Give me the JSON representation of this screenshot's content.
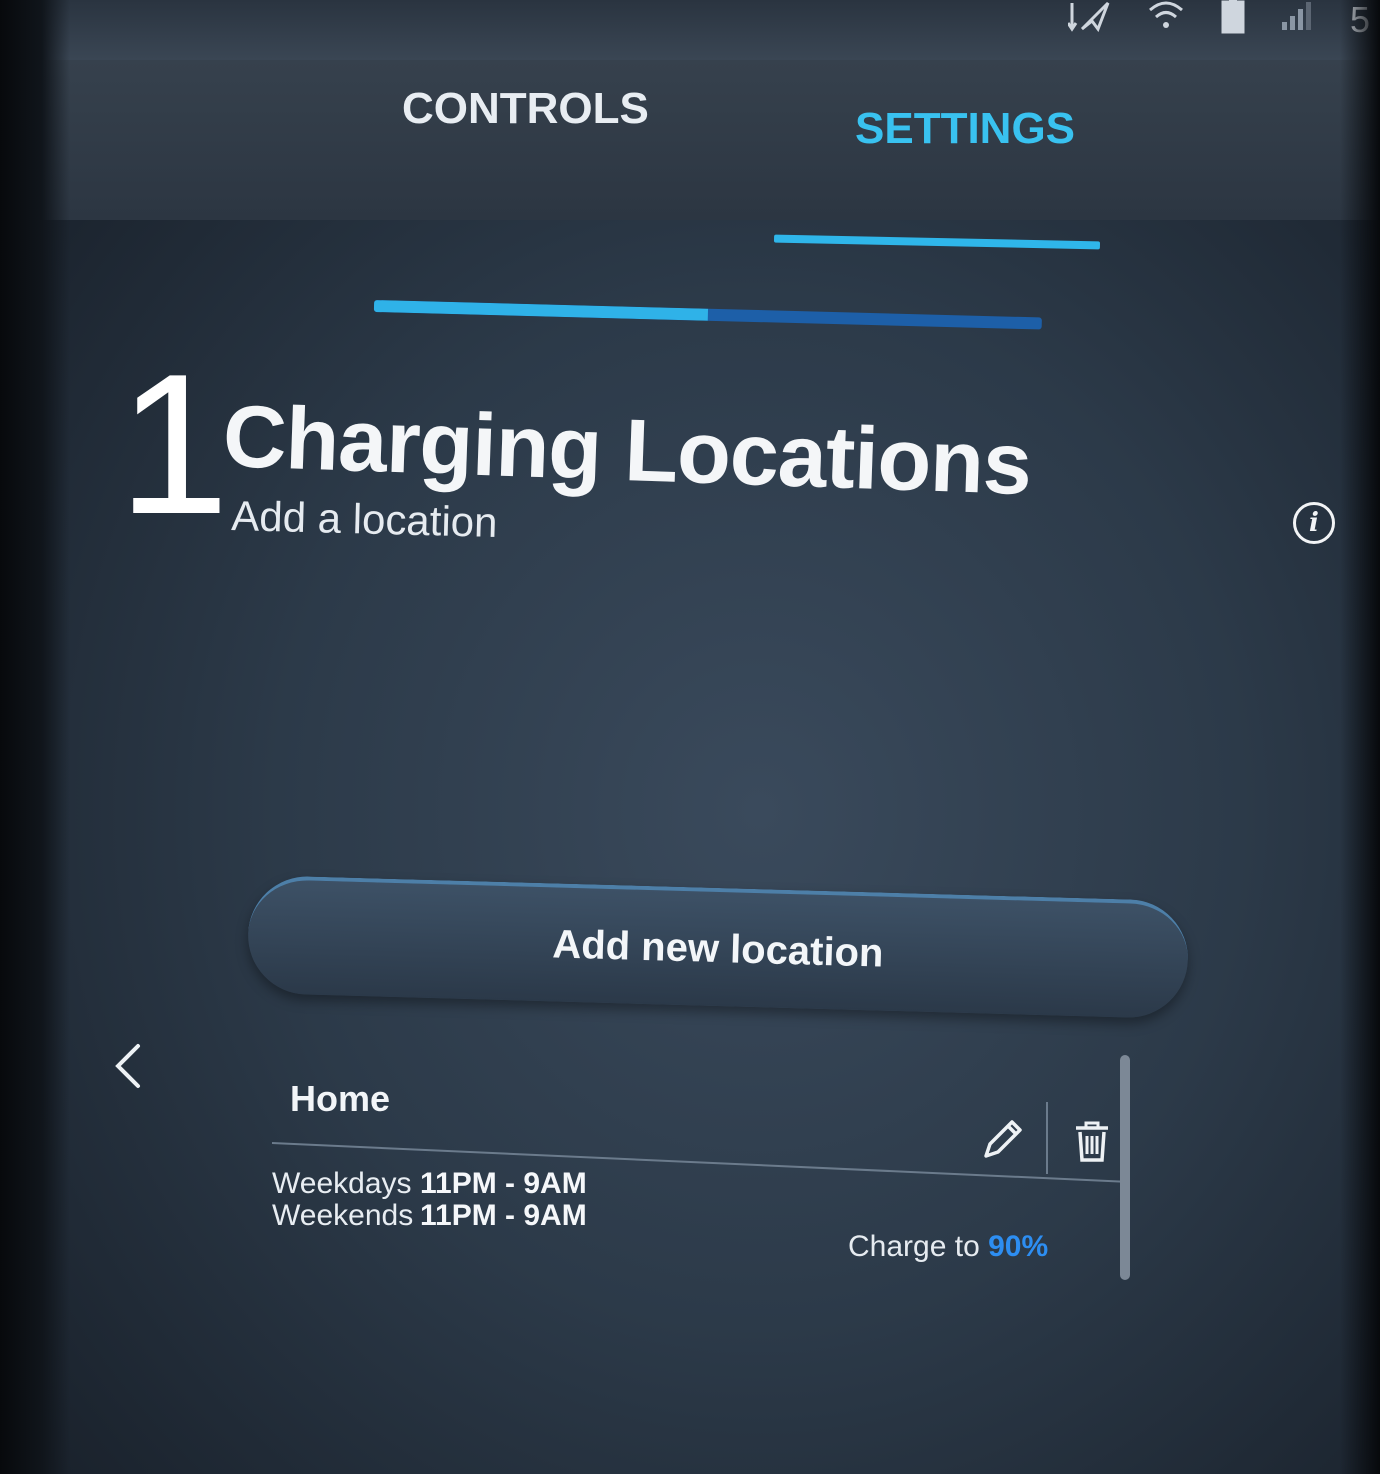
{
  "status": {
    "icons": [
      "nav-arrow-icon",
      "wifi-icon",
      "battery-icon",
      "signal-icon"
    ],
    "clock_fragment": "5"
  },
  "tabs": [
    {
      "label": "CONTROLS",
      "active": false
    },
    {
      "label": "SETTINGS",
      "active": true
    }
  ],
  "wizard": {
    "progress_percent": 50,
    "step_number": "1",
    "title": "Charging Locations",
    "subtitle": "Add a location"
  },
  "actions": {
    "add_location_label": "Add new location"
  },
  "locations": [
    {
      "name": "Home",
      "schedule": [
        {
          "day": "Weekdays",
          "time": "11PM - 9AM"
        },
        {
          "day": "Weekends",
          "time": "11PM - 9AM"
        }
      ],
      "charge_label": "Charge to",
      "charge_value": "90%"
    }
  ],
  "colors": {
    "accent": "#39c2f0",
    "progress_fill": "#2fb2e8",
    "progress_track": "#1d5fa8",
    "charge_value": "#2d8ef2"
  }
}
